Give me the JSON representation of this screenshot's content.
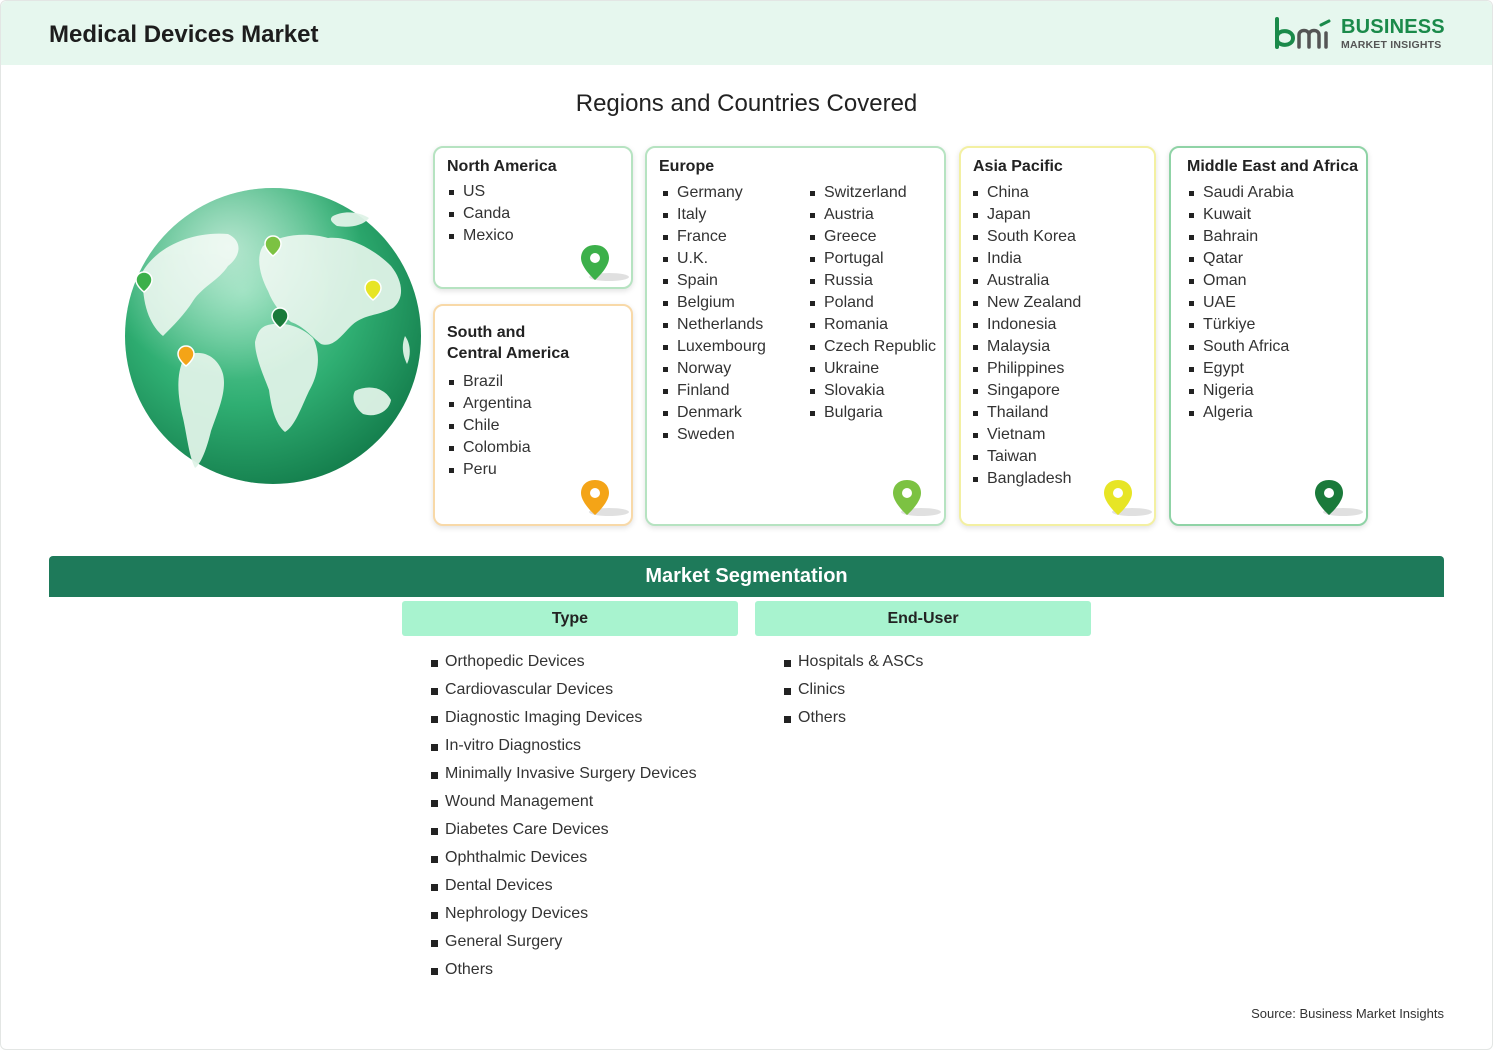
{
  "header": {
    "title": "Medical Devices Market"
  },
  "logo": {
    "brand": "BUSINESS",
    "sub": "MARKET INSIGHTS"
  },
  "regions_title": "Regions and Countries Covered",
  "regions": {
    "north_america": {
      "title": "North America",
      "countries": [
        "US",
        "Canda",
        "Mexico"
      ],
      "pin_color": "#3cb04a"
    },
    "south_central_america": {
      "title_line1": "South and",
      "title_line2": "Central America",
      "countries": [
        "Brazil",
        "Argentina",
        "Chile",
        "Colombia",
        "Peru"
      ],
      "pin_color": "#f4a417"
    },
    "europe": {
      "title": "Europe",
      "countries_col1": [
        "Germany",
        "Italy",
        "France",
        "U.K.",
        "Spain",
        "Belgium",
        "Netherlands",
        "Luxembourg",
        "Norway",
        "Finland",
        "Denmark",
        "Sweden"
      ],
      "countries_col2": [
        "Switzerland",
        "Austria",
        "Greece",
        "Portugal",
        "Russia",
        "Poland",
        "Romania",
        "Czech Republic",
        "Ukraine",
        "Slovakia",
        "Bulgaria"
      ],
      "pin_color": "#7cc242"
    },
    "asia_pacific": {
      "title": "Asia Pacific",
      "countries": [
        "China",
        "Japan",
        "South Korea",
        "India",
        "Australia",
        "New Zealand",
        "Indonesia",
        "Malaysia",
        "Philippines",
        "Singapore",
        "Thailand",
        "Vietnam",
        "Taiwan",
        "Bangladesh"
      ],
      "pin_color": "#e7e525"
    },
    "middle_east_africa": {
      "title": "Middle East and Africa",
      "countries": [
        "Saudi Arabia",
        "Kuwait",
        "Bahrain",
        "Qatar",
        "Oman",
        "UAE",
        "Türkiye",
        "South Africa",
        "Egypt",
        "Nigeria",
        "Algeria"
      ],
      "pin_color": "#1a7a3a"
    }
  },
  "segmentation": {
    "title": "Market Segmentation",
    "type": {
      "header": "Type",
      "items": [
        "Orthopedic Devices",
        "Cardiovascular Devices",
        "Diagnostic Imaging Devices",
        "In-vitro Diagnostics",
        "Minimally Invasive Surgery Devices",
        "Wound Management",
        "Diabetes Care Devices",
        "Ophthalmic Devices",
        "Dental Devices",
        "Nephrology Devices",
        "General Surgery",
        "Others"
      ]
    },
    "end_user": {
      "header": "End-User",
      "items": [
        "Hospitals & ASCs",
        "Clinics",
        "Others"
      ]
    }
  },
  "source": "Source: Business Market Insights",
  "colors": {
    "header_bg": "#e6f7ee",
    "seg_bar": "#1e7a5a",
    "col_head": "#a8f3cf",
    "brand_green": "#1a8a4a"
  },
  "icons": [
    "globe-icon",
    "map-pin-icon",
    "logo-icon"
  ]
}
